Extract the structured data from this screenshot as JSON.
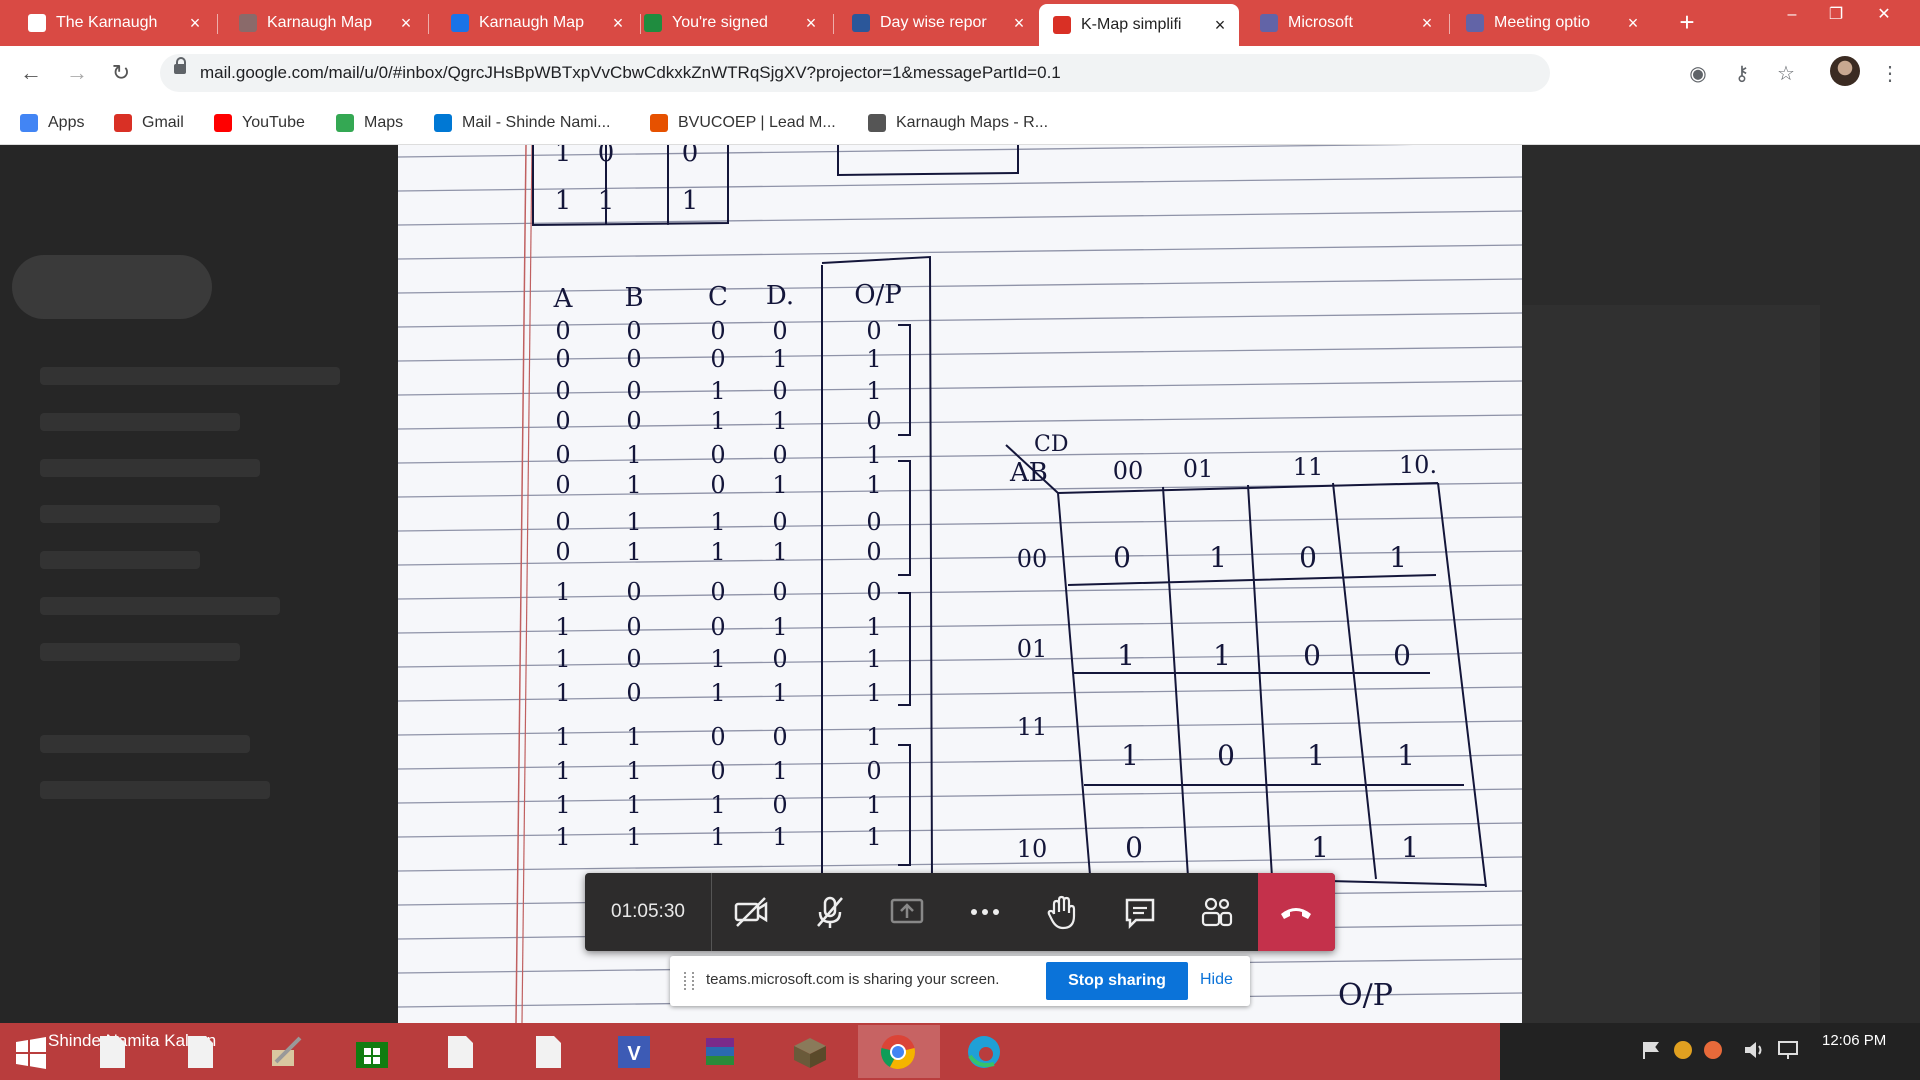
{
  "browser": {
    "tabs": [
      {
        "title": "The Karnaugh",
        "icon": "doc-icon",
        "color": "#ffffff"
      },
      {
        "title": "Karnaugh Map",
        "icon": "site-icon",
        "color": "#8a6a6a"
      },
      {
        "title": "Karnaugh Map",
        "icon": "calendar-icon",
        "color": "#1a73e8"
      },
      {
        "title": "You're signed",
        "icon": "skype-icon",
        "color": "#1f8c3f"
      },
      {
        "title": "Day wise repor",
        "icon": "word-icon",
        "color": "#2b579a"
      },
      {
        "title": "K-Map simplifi",
        "icon": "gmail-icon",
        "color": "#d93025"
      },
      {
        "title": "Microsoft",
        "icon": "teams-icon",
        "color": "#6264a7"
      },
      {
        "title": "Meeting optio",
        "icon": "teams-icon",
        "color": "#6264a7"
      }
    ],
    "active_tab": 5,
    "new_tab": "+",
    "window_controls": {
      "minimize": "–",
      "restore": "❐",
      "close": "✕"
    },
    "url": "mail.google.com/mail/u/0/#inbox/QgrcJHsBpWBTxpVvCbwCdkxkZnWTRqSjgXV?projector=1&messagePartId=0.1",
    "bookmarks": [
      {
        "label": "Apps",
        "icon": "apps-grid-icon",
        "color": "#4285f4"
      },
      {
        "label": "Gmail",
        "icon": "gmail-icon",
        "color": "#d93025"
      },
      {
        "label": "YouTube",
        "icon": "youtube-icon",
        "color": "#ff0000"
      },
      {
        "label": "Maps",
        "icon": "maps-icon",
        "color": "#34a853"
      },
      {
        "label": "Mail - Shinde Nami...",
        "icon": "outlook-icon",
        "color": "#0078d4"
      },
      {
        "label": "BVUCOEP | Lead M...",
        "icon": "bookmark-icon",
        "color": "#e65100"
      },
      {
        "label": "Karnaugh Maps - R...",
        "icon": "globe-icon",
        "color": "#555555"
      }
    ]
  },
  "document": {
    "truth_table": {
      "headers": [
        "A",
        "B",
        "C",
        "D.",
        "O/P"
      ],
      "rows": [
        [
          "0",
          "0",
          "0",
          "0",
          "0"
        ],
        [
          "0",
          "0",
          "0",
          "1",
          "1"
        ],
        [
          "0",
          "0",
          "1",
          "0",
          "1"
        ],
        [
          "0",
          "0",
          "1",
          "1",
          "0"
        ],
        [
          "0",
          "1",
          "0",
          "0",
          "1"
        ],
        [
          "0",
          "1",
          "0",
          "1",
          "1"
        ],
        [
          "0",
          "1",
          "1",
          "0",
          "0"
        ],
        [
          "0",
          "1",
          "1",
          "1",
          "0"
        ],
        [
          "1",
          "0",
          "0",
          "0",
          "0"
        ],
        [
          "1",
          "0",
          "0",
          "1",
          "1"
        ],
        [
          "1",
          "0",
          "1",
          "0",
          "1"
        ],
        [
          "1",
          "0",
          "1",
          "1",
          "1"
        ],
        [
          "1",
          "1",
          "0",
          "0",
          "1"
        ],
        [
          "1",
          "1",
          "0",
          "1",
          "0"
        ],
        [
          "1",
          "1",
          "1",
          "0",
          "1"
        ],
        [
          "1",
          "1",
          "1",
          "1",
          "1"
        ]
      ],
      "fragment_top": [
        [
          "1",
          "0",
          "0"
        ],
        [
          "1",
          "1",
          "1"
        ]
      ]
    },
    "kmap": {
      "row_var": "AB",
      "col_var": "CD",
      "col_labels": [
        "00",
        "01",
        "11",
        "10."
      ],
      "row_labels": [
        "00",
        "01",
        "11",
        "10"
      ],
      "cells": [
        [
          "0",
          "1",
          "0",
          "1"
        ],
        [
          "1",
          "1",
          "0",
          "0"
        ],
        [
          "1",
          "0",
          "1",
          "1"
        ],
        [
          "0",
          "",
          "1",
          "1"
        ]
      ]
    },
    "bottom_text": "O/P"
  },
  "teams": {
    "timer": "01:05:30",
    "controls": [
      "camera-off-icon",
      "mic-off-icon",
      "share-screen-icon",
      "more-icon",
      "raise-hand-icon",
      "chat-icon",
      "participants-icon",
      "hang-up-icon"
    ],
    "share_message": "teams.microsoft.com is sharing your screen.",
    "stop_label": "Stop sharing",
    "hide_label": "Hide"
  },
  "taskbar": {
    "user": "Shinde Namita Kalyan",
    "time": "12:06 PM"
  }
}
